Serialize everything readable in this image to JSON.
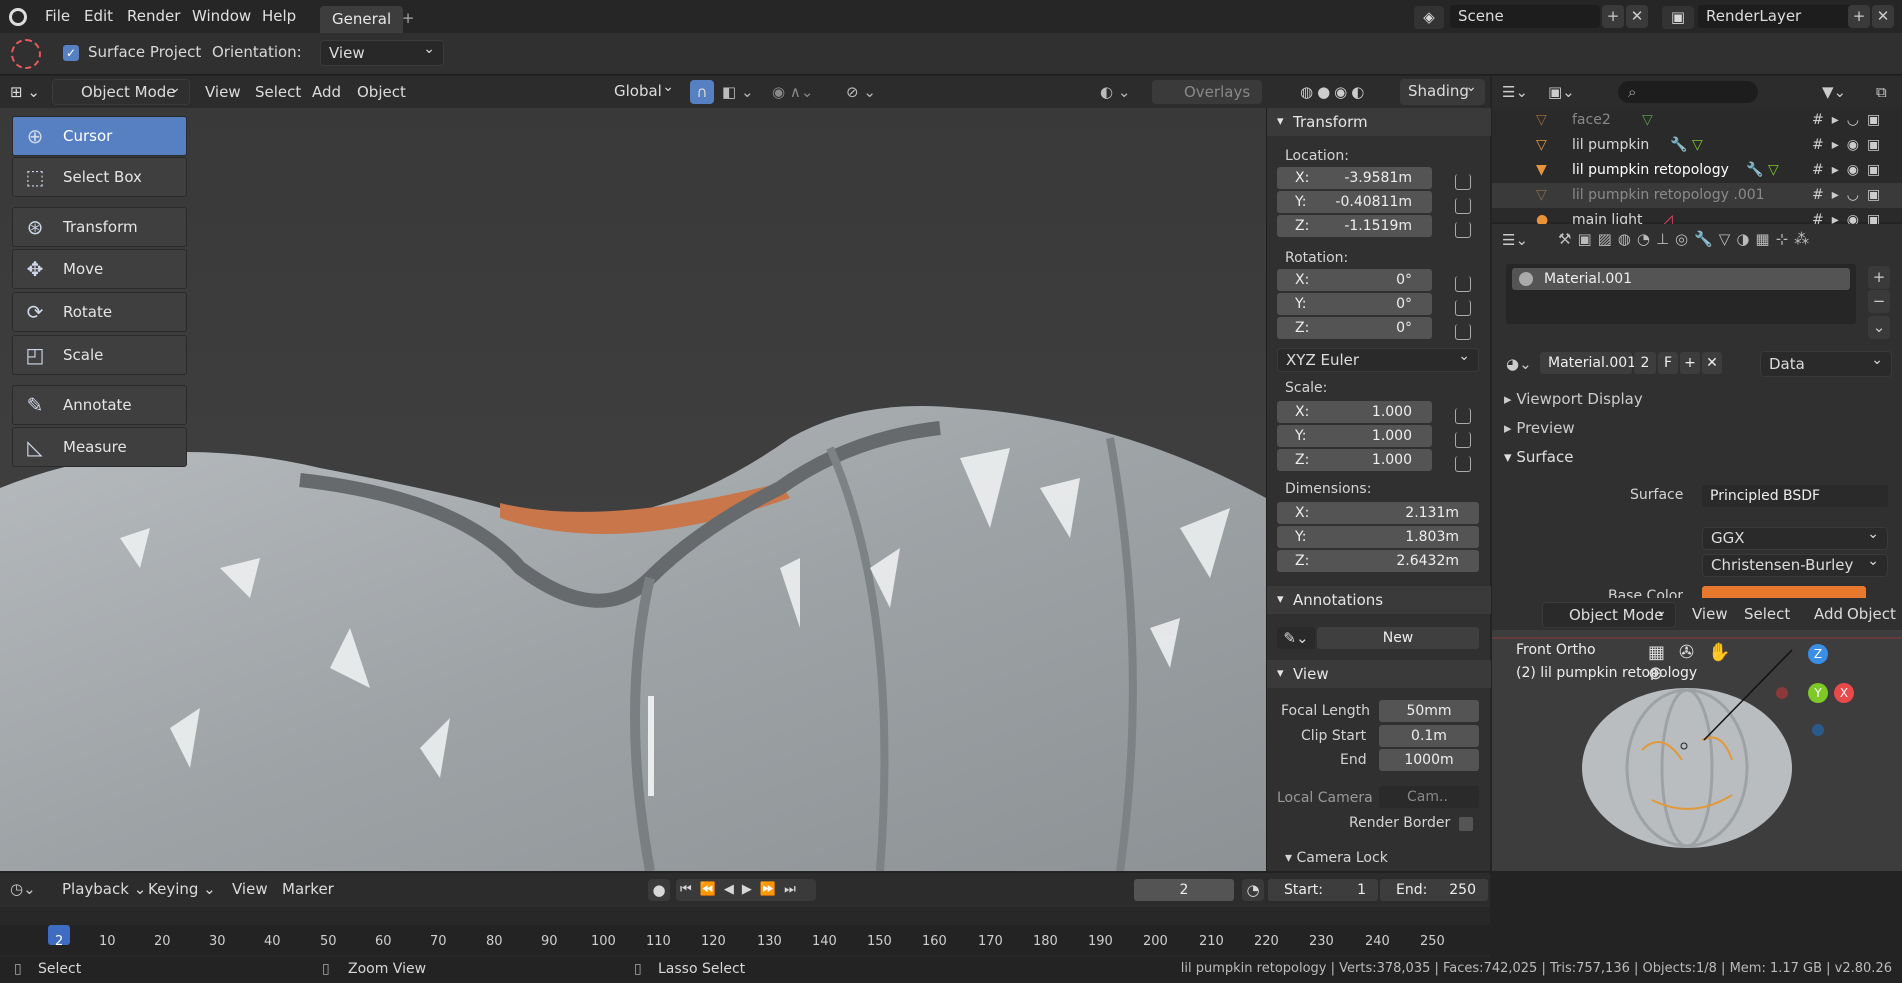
{
  "menubar": {
    "items": [
      "File",
      "Edit",
      "Render",
      "Window",
      "Help"
    ],
    "workspace_tab": "General",
    "scene": "Scene",
    "render_layer": "RenderLayer"
  },
  "toolbar": {
    "surface_project": "Surface Project",
    "orientation_label": "Orientation:",
    "orientation_value": "View"
  },
  "viewport_header": {
    "mode": "Object Mode",
    "menus": [
      "View",
      "Select",
      "Add",
      "Object"
    ],
    "transform_orientation": "Global",
    "overlays": "Overlays",
    "shading": "Shading"
  },
  "tools": [
    "Cursor",
    "Select Box",
    "Transform",
    "Move",
    "Rotate",
    "Scale",
    "Annotate",
    "Measure"
  ],
  "npanel": {
    "transform_title": "Transform",
    "location_label": "Location:",
    "location": {
      "x": "-3.9581m",
      "y": "-0.40811m",
      "z": "-1.1519m"
    },
    "rotation_label": "Rotation:",
    "rotation": {
      "x": "0°",
      "y": "0°",
      "z": "0°"
    },
    "rotation_mode": "XYZ Euler",
    "scale_label": "Scale:",
    "scale": {
      "x": "1.000",
      "y": "1.000",
      "z": "1.000"
    },
    "dimensions_label": "Dimensions:",
    "dimensions": {
      "x": "2.131m",
      "y": "1.803m",
      "z": "2.6432m"
    },
    "axis": {
      "x": "X:",
      "y": "Y:",
      "z": "Z:"
    },
    "annotations_title": "Annotations",
    "new_label": "New",
    "view_title": "View",
    "focal_length_label": "Focal Length",
    "focal_length": "50mm",
    "clip_start_label": "Clip Start",
    "clip_start": "0.1m",
    "end_label": "End",
    "clip_end": "1000m",
    "local_camera_label": "Local Camera",
    "local_camera": "Cam..",
    "render_border": "Render Border",
    "camera_lock": "Camera Lock"
  },
  "outliner": {
    "rows": [
      "face2",
      "lil pumpkin",
      "lil pumpkin retopology",
      "lil pumpkin retopology .001",
      "main light"
    ]
  },
  "properties": {
    "material_slot": "Material.001",
    "material_name": "Material.001",
    "users": "2",
    "fake_user": "F",
    "link": "Data",
    "sections": [
      "Viewport Display",
      "Preview",
      "Surface"
    ],
    "surface_label": "Surface",
    "surface_value": "Principled BSDF",
    "distribution": "GGX",
    "subsurface": "Christensen-Burley",
    "base_color_label": "Base Color",
    "base_color": "#e8782e"
  },
  "mini_viewport": {
    "mode": "Object Mode",
    "menus": [
      "View",
      "Select",
      "Add",
      "Object"
    ],
    "view_name": "Front Ortho",
    "object_label": "(2) lil pumpkin retopology"
  },
  "timeline": {
    "menus": [
      "Playback",
      "Keying",
      "View",
      "Marker"
    ],
    "current_frame": "2",
    "start_label": "Start:",
    "start": "1",
    "end_label": "End:",
    "end": "250",
    "ticks": [
      "2",
      "10",
      "20",
      "30",
      "40",
      "50",
      "60",
      "70",
      "80",
      "90",
      "100",
      "110",
      "120",
      "130",
      "140",
      "150",
      "160",
      "170",
      "180",
      "190",
      "200",
      "210",
      "220",
      "230",
      "240",
      "250"
    ]
  },
  "statusbar": {
    "select": "Select",
    "zoom": "Zoom View",
    "lasso": "Lasso Select",
    "stats": "lil pumpkin retopology | Verts:378,035 | Faces:742,025 | Tris:757,136 | Objects:1/8 | Mem: 1.17 GB | v2.80.26"
  },
  "colors": {
    "accent": "#5680c2",
    "pumpkin": "#c8764a",
    "x_axis": "#e84a4a",
    "y_axis": "#7ec828",
    "z_axis": "#3a8ee6"
  }
}
